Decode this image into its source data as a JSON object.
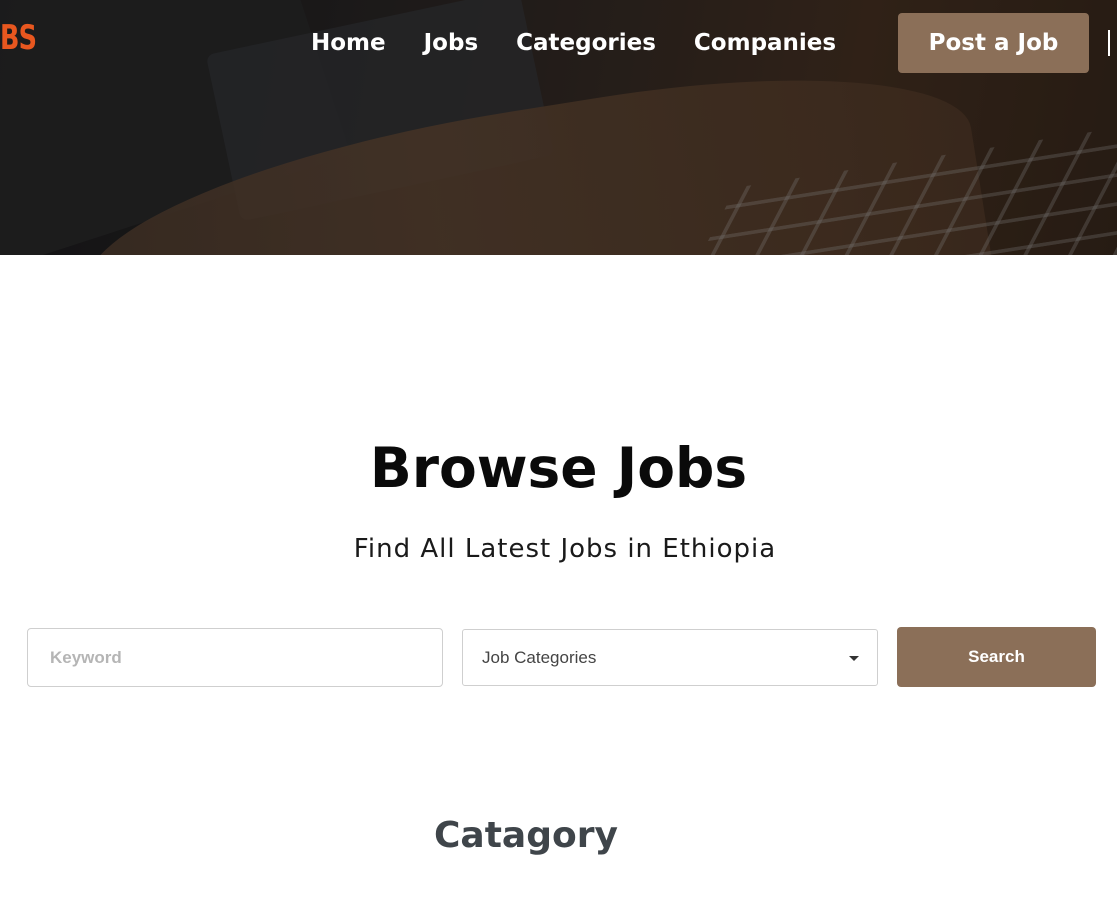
{
  "header": {
    "logo_text": "BS",
    "nav": [
      {
        "label": "Home"
      },
      {
        "label": "Jobs"
      },
      {
        "label": "Categories"
      },
      {
        "label": "Companies"
      }
    ],
    "post_job_label": "Post a Job"
  },
  "main": {
    "title": "Browse Jobs",
    "subtitle": "Find All Latest Jobs in Ethiopia",
    "search": {
      "keyword_placeholder": "Keyword",
      "keyword_value": "",
      "category_selected": "Job Categories",
      "search_label": "Search"
    },
    "category_heading": "Catagory"
  },
  "colors": {
    "accent": "#8b6f58",
    "logo": "#e8571f",
    "title": "#0a0a0a",
    "category_heading": "#3f454a"
  },
  "icons": {
    "select_caret": "caret-down-icon"
  }
}
